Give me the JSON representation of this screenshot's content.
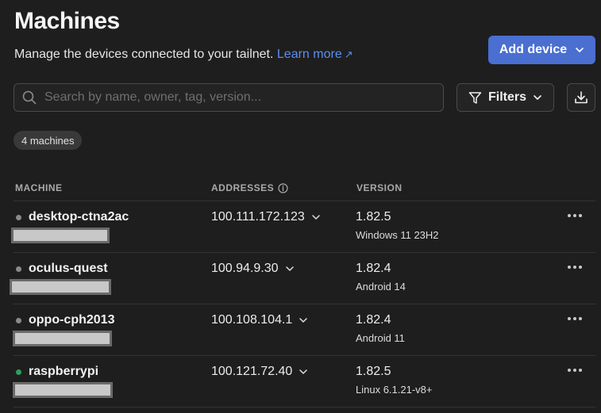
{
  "header": {
    "title": "Machines",
    "subtitle": "Manage the devices connected to your tailnet.",
    "learn_more": "Learn more",
    "add_device": "Add device"
  },
  "toolbar": {
    "search_placeholder": "Search by name, owner, tag, version...",
    "filters_label": "Filters"
  },
  "summary": {
    "count_label": "4 machines"
  },
  "table": {
    "columns": [
      "MACHINE",
      "ADDRESSES",
      "VERSION"
    ],
    "rows": [
      {
        "name": "desktop-ctna2ac",
        "address": "100.111.172.123",
        "version": "1.82.5",
        "os": "Windows 11 23H2",
        "status": "offline"
      },
      {
        "name": "oculus-quest",
        "address": "100.94.9.30",
        "version": "1.82.4",
        "os": "Android 14",
        "status": "offline"
      },
      {
        "name": "oppo-cph2013",
        "address": "100.108.104.1",
        "version": "1.82.4",
        "os": "Android 11",
        "status": "offline"
      },
      {
        "name": "raspberrypi",
        "address": "100.121.72.40",
        "version": "1.82.5",
        "os": "Linux 6.1.21-v8+",
        "status": "online"
      }
    ]
  },
  "colors": {
    "background": "#1f1e1e",
    "accent": "#4a6fd1",
    "link": "#5b8ef0",
    "status_online": "#2f9e5b",
    "status_offline": "#8a8a8a"
  },
  "icons": {
    "search": "search-icon",
    "filter": "filter-icon",
    "download": "download-icon",
    "chevron": "chevron-down-icon",
    "info": "info-icon",
    "more": "more-icon"
  }
}
